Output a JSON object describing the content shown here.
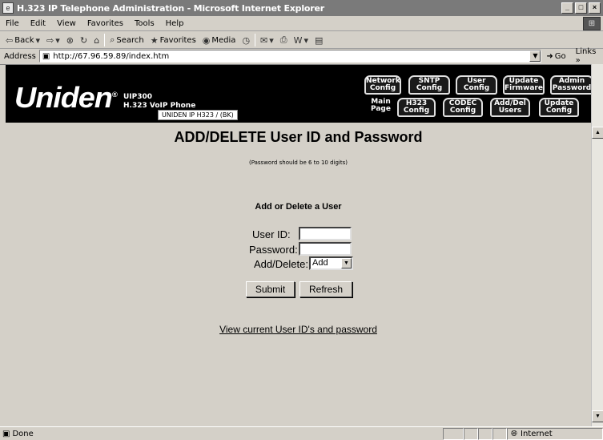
{
  "window": {
    "title": "H.323 IP Telephone Administration - Microsoft Internet Explorer",
    "app_icon": "ie-icon",
    "controls": [
      "_",
      "□",
      "×"
    ]
  },
  "menu": [
    "File",
    "Edit",
    "View",
    "Favorites",
    "Tools",
    "Help"
  ],
  "toolbar": {
    "back": "Back",
    "search": "Search",
    "favorites": "Favorites",
    "media": "Media"
  },
  "address": {
    "label": "Address",
    "url": "http://67.96.59.89/index.htm",
    "go": "Go",
    "links": "Links"
  },
  "banner": {
    "logo": "Uniden",
    "model": "UIP300",
    "product": "H.323 VoIP Phone",
    "device": "UNIDEN IP H323 / (BK)",
    "main_page": [
      "Main",
      "Page"
    ],
    "nav_top": [
      {
        "l1": "Network",
        "l2": "Config"
      },
      {
        "l1": "SNTP",
        "l2": "Config"
      },
      {
        "l1": "User",
        "l2": "Config"
      },
      {
        "l1": "Update",
        "l2": "Firmware"
      },
      {
        "l1": "Admin",
        "l2": "Password"
      }
    ],
    "nav_bottom": [
      {
        "l1": "H323",
        "l2": "Config"
      },
      {
        "l1": "CODEC",
        "l2": "Config"
      },
      {
        "l1": "Add/Del",
        "l2": "Users"
      },
      {
        "l1": "Update",
        "l2": "Config"
      }
    ]
  },
  "content": {
    "title": "ADD/DELETE User ID and Password",
    "note": "(Password should be 6 to 10 digits)",
    "section": "Add or Delete a User",
    "user_id_label": "User ID:",
    "password_label": "Password:",
    "action_label": "Add/Delete:",
    "user_id_value": "",
    "password_value": "",
    "action_value": "Add",
    "submit": "Submit",
    "refresh": "Refresh",
    "link": "View current User ID's and password"
  },
  "status": {
    "text": "Done",
    "zone": "Internet"
  }
}
